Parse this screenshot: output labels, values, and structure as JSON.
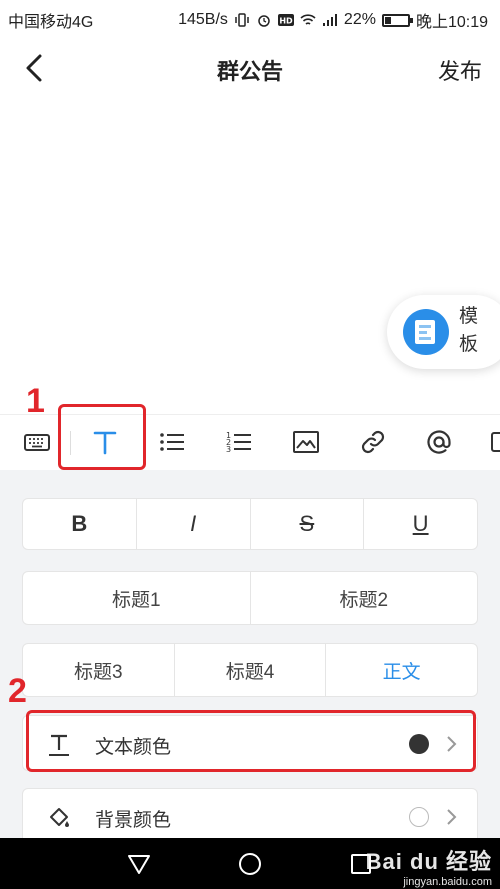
{
  "status_bar": {
    "carrier": "中国移动4G",
    "speed": "145B/s",
    "battery": "22%",
    "time": "晚上10:19"
  },
  "header": {
    "title": "群公告",
    "publish_label": "发布"
  },
  "template_button": {
    "label": "模板"
  },
  "toolbar": {
    "items": [
      "keyboard-icon",
      "text-format-icon",
      "bullet-list-icon",
      "numbered-list-icon",
      "image-icon",
      "link-icon",
      "mention-icon"
    ]
  },
  "annotations": {
    "one": "1",
    "two": "2"
  },
  "format_panel": {
    "styles": {
      "bold": "B",
      "italic": "I",
      "strike": "S",
      "underline": "U"
    },
    "headings_row1": [
      "标题1",
      "标题2"
    ],
    "headings_row2": [
      "标题3",
      "标题4",
      "正文"
    ],
    "text_color": {
      "label": "文本颜色",
      "value": "#333333"
    },
    "bg_color": {
      "label": "背景颜色",
      "value": "#ffffff"
    }
  },
  "watermark": {
    "line1": "Bai du 经验",
    "line2": "jingyan.baidu.com"
  },
  "colors": {
    "accent": "#2a8ee8",
    "annotation": "#e1262b"
  }
}
